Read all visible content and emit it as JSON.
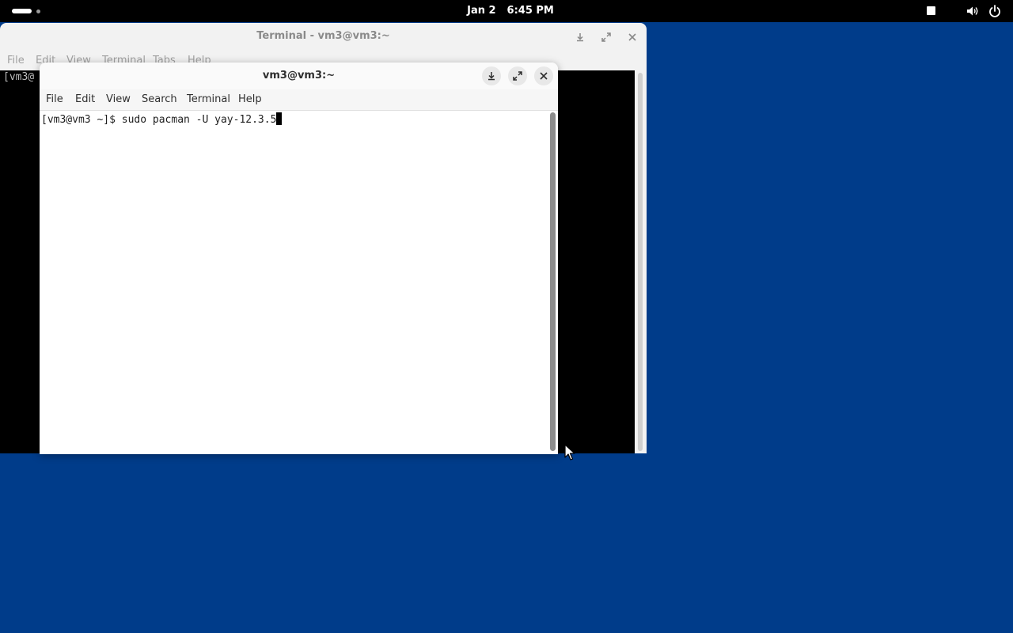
{
  "topbar": {
    "date": "Jan 2",
    "time": "6:45 PM",
    "icons": [
      "activities-indicator",
      "tray-square-icon",
      "volume-icon",
      "power-icon"
    ]
  },
  "background_window": {
    "title": "Terminal - vm3@vm3:~",
    "menu": [
      "File",
      "Edit",
      "View",
      "Terminal",
      "Tabs",
      "Help"
    ],
    "prompt_fragment": "[vm3@",
    "buttons": [
      "minimize-icon",
      "maximize-icon",
      "close-icon"
    ]
  },
  "foreground_window": {
    "title": "vm3@vm3:~",
    "menu": [
      "File",
      "Edit",
      "View",
      "Search",
      "Terminal",
      "Help"
    ],
    "prompt": "[vm3@vm3 ~]$ ",
    "command": "sudo pacman -U yay-12.3.5",
    "buttons": [
      "minimize-icon",
      "maximize-icon",
      "close-icon"
    ]
  },
  "colors": {
    "desktop": "#003c8a",
    "topbar": "#000000",
    "terminal_bg_dark": "#000000",
    "terminal_bg_light": "#ffffff"
  }
}
